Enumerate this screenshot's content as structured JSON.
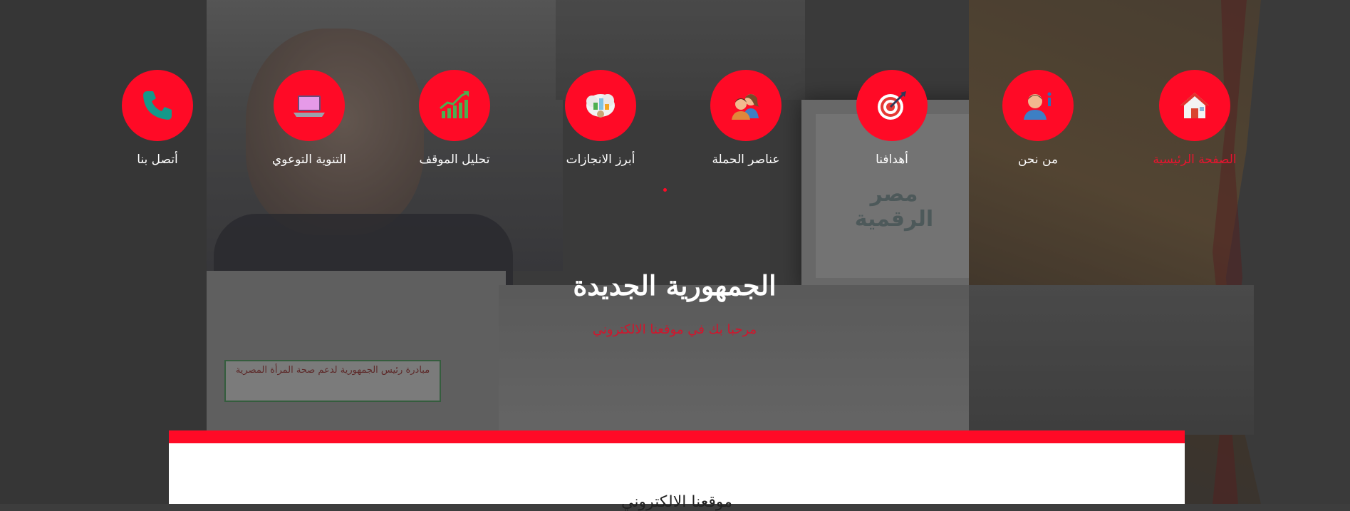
{
  "nav": {
    "items": [
      {
        "label": "الصفحة الرئيسية",
        "icon": "house-icon",
        "active": true
      },
      {
        "label": "من نحن",
        "icon": "person-info-icon",
        "active": false
      },
      {
        "label": "أهدافنا",
        "icon": "target-icon",
        "active": false
      },
      {
        "label": "عناصر الحملة",
        "icon": "team-icon",
        "active": false
      },
      {
        "label": "أبرز الانجازات",
        "icon": "achievements-icon",
        "active": false
      },
      {
        "label": "تحليل الموقف",
        "icon": "chart-growth-icon",
        "active": false
      },
      {
        "label": "التنوية التوعوي",
        "icon": "laptop-icon",
        "active": false
      },
      {
        "label": "أتصل بنا",
        "icon": "phone-icon",
        "active": false
      }
    ]
  },
  "hero": {
    "title": "الجمهورية الجديدة",
    "subtitle": "مرحبا بك في موقعنا الالكتروني",
    "background_logo_text": "مصر الرقمية",
    "background_box_text": "مبادرة رئيس الجمهورية لدعم صحة المرأة المصرية"
  },
  "content": {
    "heading": "موقعنا الالكتروني"
  },
  "colors": {
    "accent": "#ff0a26",
    "active_text": "#e8142f",
    "subtitle": "#d3142c"
  }
}
